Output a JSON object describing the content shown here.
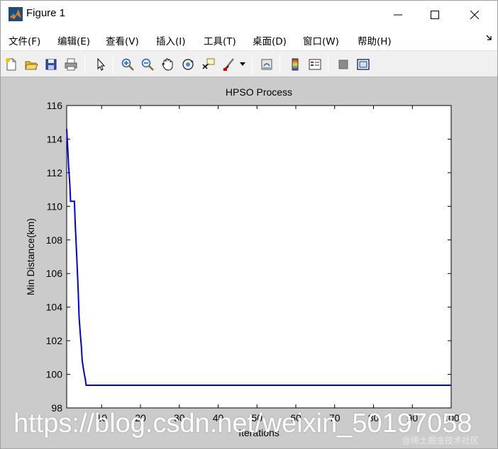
{
  "window": {
    "title": "Figure 1"
  },
  "menu": [
    {
      "label": "文件(F)"
    },
    {
      "label": "编辑(E)"
    },
    {
      "label": "查看(V)"
    },
    {
      "label": "插入(I)"
    },
    {
      "label": "工具(T)"
    },
    {
      "label": "桌面(D)"
    },
    {
      "label": "窗口(W)"
    },
    {
      "label": "帮助(H)"
    }
  ],
  "toolbar": {
    "icons": [
      "new-file-icon",
      "open-folder-icon",
      "save-icon",
      "print-icon",
      "pointer-icon",
      "zoom-in-icon",
      "zoom-out-icon",
      "pan-hand-icon",
      "rotate-3d-icon",
      "data-cursor-icon",
      "brush-icon",
      "link-plot-icon",
      "colorbar-icon",
      "legend-icon",
      "hide-plot-tools-icon",
      "show-plot-tools-icon"
    ]
  },
  "chart_data": {
    "type": "line",
    "title": "HPSO Process",
    "xlabel": "Iterations",
    "ylabel": "Min Distance(km)",
    "xlim": [
      1,
      100
    ],
    "ylim": [
      98,
      116
    ],
    "xticks": [
      10,
      20,
      30,
      40,
      50,
      60,
      70,
      80,
      90,
      100
    ],
    "yticks": [
      98,
      100,
      102,
      104,
      106,
      108,
      110,
      112,
      114,
      116
    ],
    "grid": false,
    "line_color": "#0000e0",
    "series": [
      {
        "x": [
          1,
          1.2,
          1.5,
          1.8,
          2,
          2.5,
          3,
          3.2,
          3.6,
          4,
          4.2,
          4.5,
          4.8,
          5,
          5.4,
          5.8,
          6,
          7,
          100
        ],
        "values": [
          114.6,
          113.8,
          112.4,
          111.3,
          110.3,
          110.3,
          110.3,
          109.0,
          107.0,
          104.8,
          103.4,
          102.4,
          101.6,
          100.8,
          100.2,
          99.7,
          99.35,
          99.35,
          99.35
        ]
      }
    ]
  },
  "watermark": {
    "url": "https://blog.csdn.net/weixin_50197058",
    "credit": "@稀土掘金技术社区"
  }
}
